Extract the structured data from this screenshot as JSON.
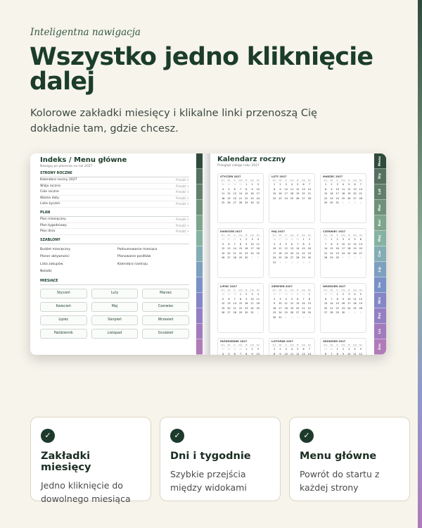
{
  "eyebrow": "Inteligentna nawigacja",
  "headline": "Wszystko jedno kliknięcie dalej",
  "subtitle": "Kolorowe zakładki miesięcy i klikalne linki przenoszą Cię dokładnie tam, gdzie chcesz.",
  "index_page": {
    "title": "Indeks / Menu główne",
    "subtitle": "Nawiguj po planerze na rok 2027",
    "go_label": "Przejdź >",
    "sections": {
      "yearly": {
        "title": "STRONY ROCZNE",
        "items": [
          "Kalendarz roczny 2027",
          "Wizja roczna",
          "Cele roczne",
          "Ważne daty",
          "Lista życzeń"
        ]
      },
      "plan": {
        "title": "PLAN",
        "items": [
          "Plan miesięczny",
          "Plan tygodniowy",
          "Plan dnia"
        ]
      },
      "templates": {
        "title": "SZABLONY",
        "items": [
          "Budżet miesięczny",
          "Podsumowanie miesiąca",
          "Planer aktywności",
          "Planowanie posiłków",
          "Lista zakupów",
          "Kalendarz nastroju",
          "Notatki"
        ]
      },
      "months": {
        "title": "MIESIĄCE",
        "items": [
          "Styczeń",
          "Luty",
          "Marzec",
          "Kwiecień",
          "Maj",
          "Czerwiec",
          "Lipiec",
          "Sierpień",
          "Wrzesień",
          "Październik",
          "Listopad",
          "Grudzień"
        ]
      }
    }
  },
  "calendar_page": {
    "title": "Kalendarz roczny",
    "subtitle": "Przegląd całego roku 2027",
    "weekdays": [
      "Pon",
      "Wt",
      "Śr",
      "Czw",
      "Pt",
      "Sob",
      "Nd"
    ],
    "months": [
      {
        "name": "STYCZEŃ 2027",
        "offset": 4,
        "days": 31
      },
      {
        "name": "LUTY 2027",
        "offset": 0,
        "days": 28
      },
      {
        "name": "MARZEC 2027",
        "offset": 0,
        "days": 31
      },
      {
        "name": "KWIECIEŃ 2027",
        "offset": 3,
        "days": 30
      },
      {
        "name": "MAJ 2027",
        "offset": 5,
        "days": 31
      },
      {
        "name": "CZERWIEC 2027",
        "offset": 1,
        "days": 30
      },
      {
        "name": "LIPIEC 2027",
        "offset": 3,
        "days": 31
      },
      {
        "name": "SIERPIEŃ 2027",
        "offset": 6,
        "days": 31
      },
      {
        "name": "WRZESIEŃ 2027",
        "offset": 2,
        "days": 30
      },
      {
        "name": "PAŹDZIERNIK 2027",
        "offset": 4,
        "days": 31
      },
      {
        "name": "LISTOPAD 2027",
        "offset": 0,
        "days": 30
      },
      {
        "name": "GRUDZIEŃ 2027",
        "offset": 2,
        "days": 31
      }
    ]
  },
  "tabs": [
    {
      "label": "Menu",
      "color": "#2f4a3b"
    },
    {
      "label": "Sty",
      "color": "#54705f"
    },
    {
      "label": "Lut",
      "color": "#61806b"
    },
    {
      "label": "Mar",
      "color": "#6f917a"
    },
    {
      "label": "Kwi",
      "color": "#7ea58c"
    },
    {
      "label": "Maj",
      "color": "#86b2a2"
    },
    {
      "label": "Cze",
      "color": "#83adb4"
    },
    {
      "label": "Lip",
      "color": "#7d9fc0"
    },
    {
      "label": "Sie",
      "color": "#7991c6"
    },
    {
      "label": "Wrz",
      "color": "#8486c6"
    },
    {
      "label": "Paź",
      "color": "#937fc2"
    },
    {
      "label": "Lis",
      "color": "#a27bbd"
    },
    {
      "label": "Gru",
      "color": "#b17ab8"
    }
  ],
  "features": [
    {
      "title": "Zakładki miesięcy",
      "text": "Jedno kliknięcie do dowolnego miesiąca"
    },
    {
      "title": "Dni i tygodnie",
      "text": "Szybkie przejścia między widokami"
    },
    {
      "title": "Menu główne",
      "text": "Powrót do startu z każdej strony"
    }
  ],
  "check_glyph": "✓",
  "colors": {
    "brand": "#1b3d2a",
    "background": "#f7f4ec"
  }
}
